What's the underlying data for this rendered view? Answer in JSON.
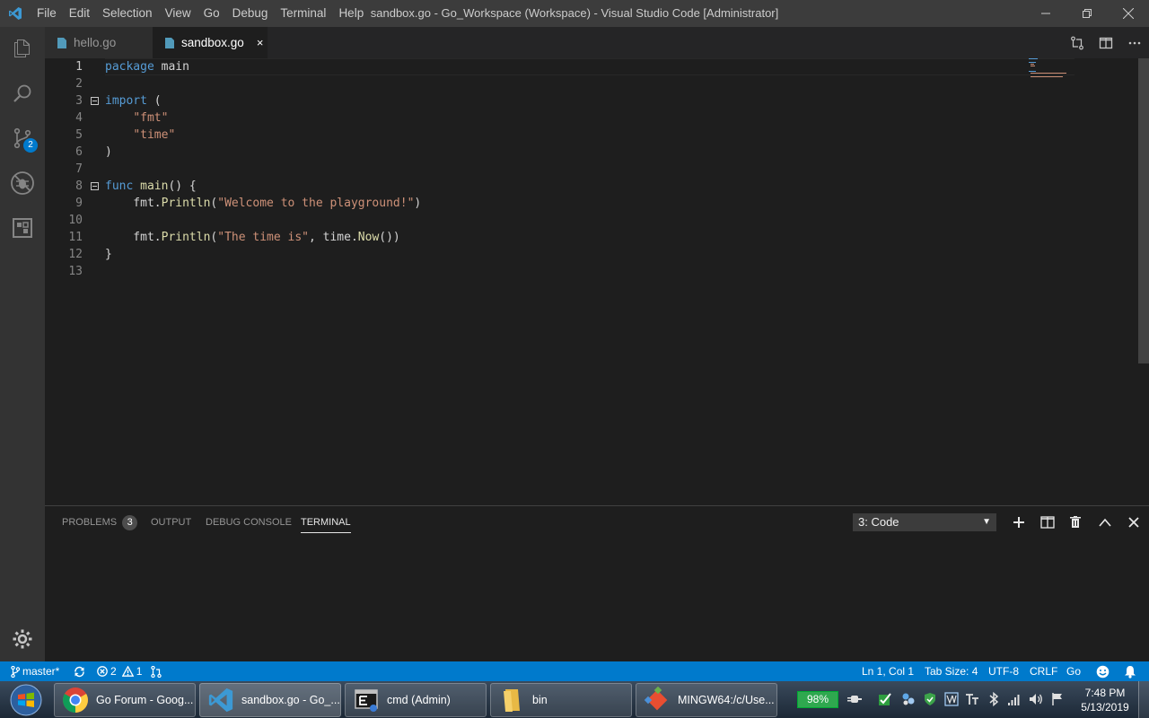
{
  "titlebar": {
    "menu": [
      "File",
      "Edit",
      "Selection",
      "View",
      "Go",
      "Debug",
      "Terminal",
      "Help"
    ],
    "window_title": "sandbox.go - Go_Workspace (Workspace) - Visual Studio Code [Administrator]"
  },
  "activity": {
    "source_control_badge": "2"
  },
  "tabs": [
    {
      "label": "hello.go",
      "active": false
    },
    {
      "label": "sandbox.go",
      "active": true,
      "close": "×"
    }
  ],
  "editor": {
    "line_numbers": [
      "1",
      "2",
      "3",
      "4",
      "5",
      "6",
      "7",
      "8",
      "9",
      "10",
      "11",
      "12",
      "13"
    ],
    "lines": [
      {
        "parts": [
          {
            "t": "package",
            "c": "kw"
          },
          {
            "t": " main",
            "c": ""
          }
        ]
      },
      {
        "parts": []
      },
      {
        "parts": [
          {
            "t": "import",
            "c": "kw"
          },
          {
            "t": " (",
            "c": ""
          }
        ]
      },
      {
        "parts": [
          {
            "t": "    ",
            "c": ""
          },
          {
            "t": "\"fmt\"",
            "c": "str"
          }
        ]
      },
      {
        "parts": [
          {
            "t": "    ",
            "c": ""
          },
          {
            "t": "\"time\"",
            "c": "str"
          }
        ]
      },
      {
        "parts": [
          {
            "t": ")",
            "c": ""
          }
        ]
      },
      {
        "parts": []
      },
      {
        "parts": [
          {
            "t": "func",
            "c": "kw"
          },
          {
            "t": " ",
            "c": ""
          },
          {
            "t": "main",
            "c": "fn"
          },
          {
            "t": "() {",
            "c": ""
          }
        ]
      },
      {
        "parts": [
          {
            "t": "    fmt.",
            "c": ""
          },
          {
            "t": "Println",
            "c": "fn"
          },
          {
            "t": "(",
            "c": ""
          },
          {
            "t": "\"Welcome to the playground!\"",
            "c": "str"
          },
          {
            "t": ")",
            "c": ""
          }
        ]
      },
      {
        "parts": []
      },
      {
        "parts": [
          {
            "t": "    fmt.",
            "c": ""
          },
          {
            "t": "Println",
            "c": "fn"
          },
          {
            "t": "(",
            "c": ""
          },
          {
            "t": "\"The time is\"",
            "c": "str"
          },
          {
            "t": ", time.",
            "c": ""
          },
          {
            "t": "Now",
            "c": "fn"
          },
          {
            "t": "())",
            "c": ""
          }
        ]
      },
      {
        "parts": [
          {
            "t": "}",
            "c": ""
          }
        ]
      },
      {
        "parts": []
      }
    ]
  },
  "panel": {
    "tabs": {
      "problems": "PROBLEMS",
      "problems_count": "3",
      "output": "OUTPUT",
      "debug_console": "DEBUG CONSOLE",
      "terminal": "TERMINAL"
    },
    "terminal_select": "3: Code"
  },
  "statusbar": {
    "branch": "master*",
    "errors": "2",
    "warnings": "1",
    "position": "Ln 1, Col 1",
    "tab_size": "Tab Size: 4",
    "encoding": "UTF-8",
    "eol": "CRLF",
    "language": "Go"
  },
  "taskbar": {
    "tasks": [
      {
        "label": "Go Forum - Goog..."
      },
      {
        "label": "sandbox.go - Go_..."
      },
      {
        "label": "cmd (Admin)"
      },
      {
        "label": "bin"
      },
      {
        "label": "MINGW64:/c/Use..."
      }
    ],
    "battery": "98%",
    "time": "7:48 PM",
    "date": "5/13/2019"
  },
  "colors": {
    "accent": "#007acc",
    "keyword": "#569cd6",
    "string": "#ce9178",
    "function": "#dcdcaa"
  }
}
